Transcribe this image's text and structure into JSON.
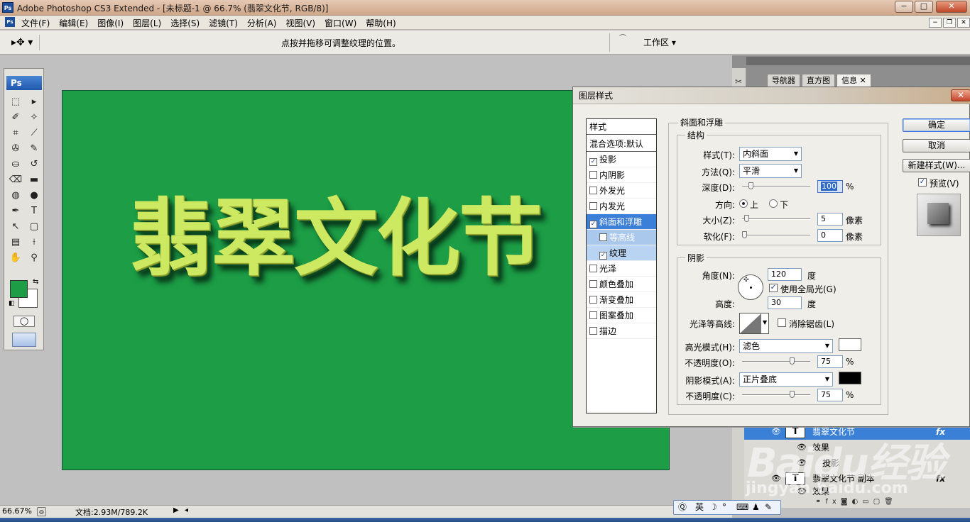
{
  "window": {
    "title": "Adobe Photoshop CS3 Extended - [未标题-1 @ 66.7% (翡翠文化节, RGB/8)]",
    "logo": "Ps",
    "min": "−",
    "max": "□",
    "close": "✕"
  },
  "menu": {
    "items": [
      "文件(F)",
      "编辑(E)",
      "图像(I)",
      "图层(L)",
      "选择(S)",
      "滤镜(T)",
      "分析(A)",
      "视图(V)",
      "窗口(W)",
      "帮助(H)"
    ]
  },
  "options": {
    "hint": "点按并拖移可调整纹理的位置。",
    "workspace": "工作区 ▾"
  },
  "toolbox": {
    "logo": "Ps",
    "fg_color": "#1c9d46",
    "bg_color": "#ffffff"
  },
  "canvas": {
    "text": "翡翠文化节",
    "bg_color": "#1c9d46"
  },
  "panels": {
    "tabs": [
      "导航器",
      "直方图",
      "信息 ✕"
    ]
  },
  "layers": {
    "rows": [
      {
        "name": "翡翠文化节",
        "thumb": "T",
        "fx": "fx"
      },
      {
        "name": "效果"
      },
      {
        "name": "投影"
      },
      {
        "name": "翡翠文化节 副本",
        "thumb": "T",
        "fx": "fx"
      },
      {
        "name": "效果"
      }
    ]
  },
  "dialog": {
    "title": "图层样式",
    "close": "✕",
    "styles_header": "样式",
    "blend_default": "混合选项:默认",
    "styles": [
      {
        "label": "投影",
        "checked": true
      },
      {
        "label": "内阴影",
        "checked": false
      },
      {
        "label": "外发光",
        "checked": false
      },
      {
        "label": "内发光",
        "checked": false
      },
      {
        "label": "斜面和浮雕",
        "checked": true,
        "selected": true
      },
      {
        "label": "等高线",
        "checked": false,
        "sub": true
      },
      {
        "label": "纹理",
        "checked": true,
        "sub": true
      },
      {
        "label": "光泽",
        "checked": false
      },
      {
        "label": "颜色叠加",
        "checked": false
      },
      {
        "label": "渐变叠加",
        "checked": false
      },
      {
        "label": "图案叠加",
        "checked": false
      },
      {
        "label": "描边",
        "checked": false
      }
    ],
    "bevel_title": "斜面和浮雕",
    "structure_title": "结构",
    "style_label": "样式(T):",
    "style_value": "内斜面",
    "technique_label": "方法(Q):",
    "technique_value": "平滑",
    "depth_label": "深度(D):",
    "depth_value": "100",
    "depth_fraction": 0.1,
    "percent": "%",
    "direction_label": "方向:",
    "dir_up": "上",
    "dir_down": "下",
    "size_label": "大小(Z):",
    "size_value": "5",
    "size_fraction": 0.03,
    "soften_label": "软化(F):",
    "soften_value": "0",
    "soften_fraction": 0.0,
    "px": "像素",
    "shading_title": "阴影",
    "angle_label": "角度(N):",
    "angle_value": "120",
    "degree": "度",
    "global_light": "使用全局光(G)",
    "altitude_label": "高度:",
    "altitude_value": "30",
    "gloss_label": "光泽等高线:",
    "antialias": "消除锯齿(L)",
    "highlight_label": "高光模式(H):",
    "highlight_value": "滤色",
    "highlight_color": "#ffffff",
    "hl_opacity_label": "不透明度(O):",
    "hl_opacity_value": "75",
    "hl_opacity_fraction": 0.75,
    "shadow_label": "阴影模式(A):",
    "shadow_value": "正片叠底",
    "shadow_color": "#000000",
    "sh_opacity_label": "不透明度(C):",
    "sh_opacity_value": "75",
    "sh_opacity_fraction": 0.75,
    "ok": "确定",
    "cancel": "取消",
    "new_style": "新建样式(W)...",
    "preview": "预览(V)"
  },
  "status": {
    "zoom": "66.67%",
    "doc": "文档:2.93M/789.2K"
  },
  "ime": {
    "lang": "英"
  },
  "watermark": {
    "text": "Baidu经验",
    "sub": "jingyan.baidu.com"
  }
}
